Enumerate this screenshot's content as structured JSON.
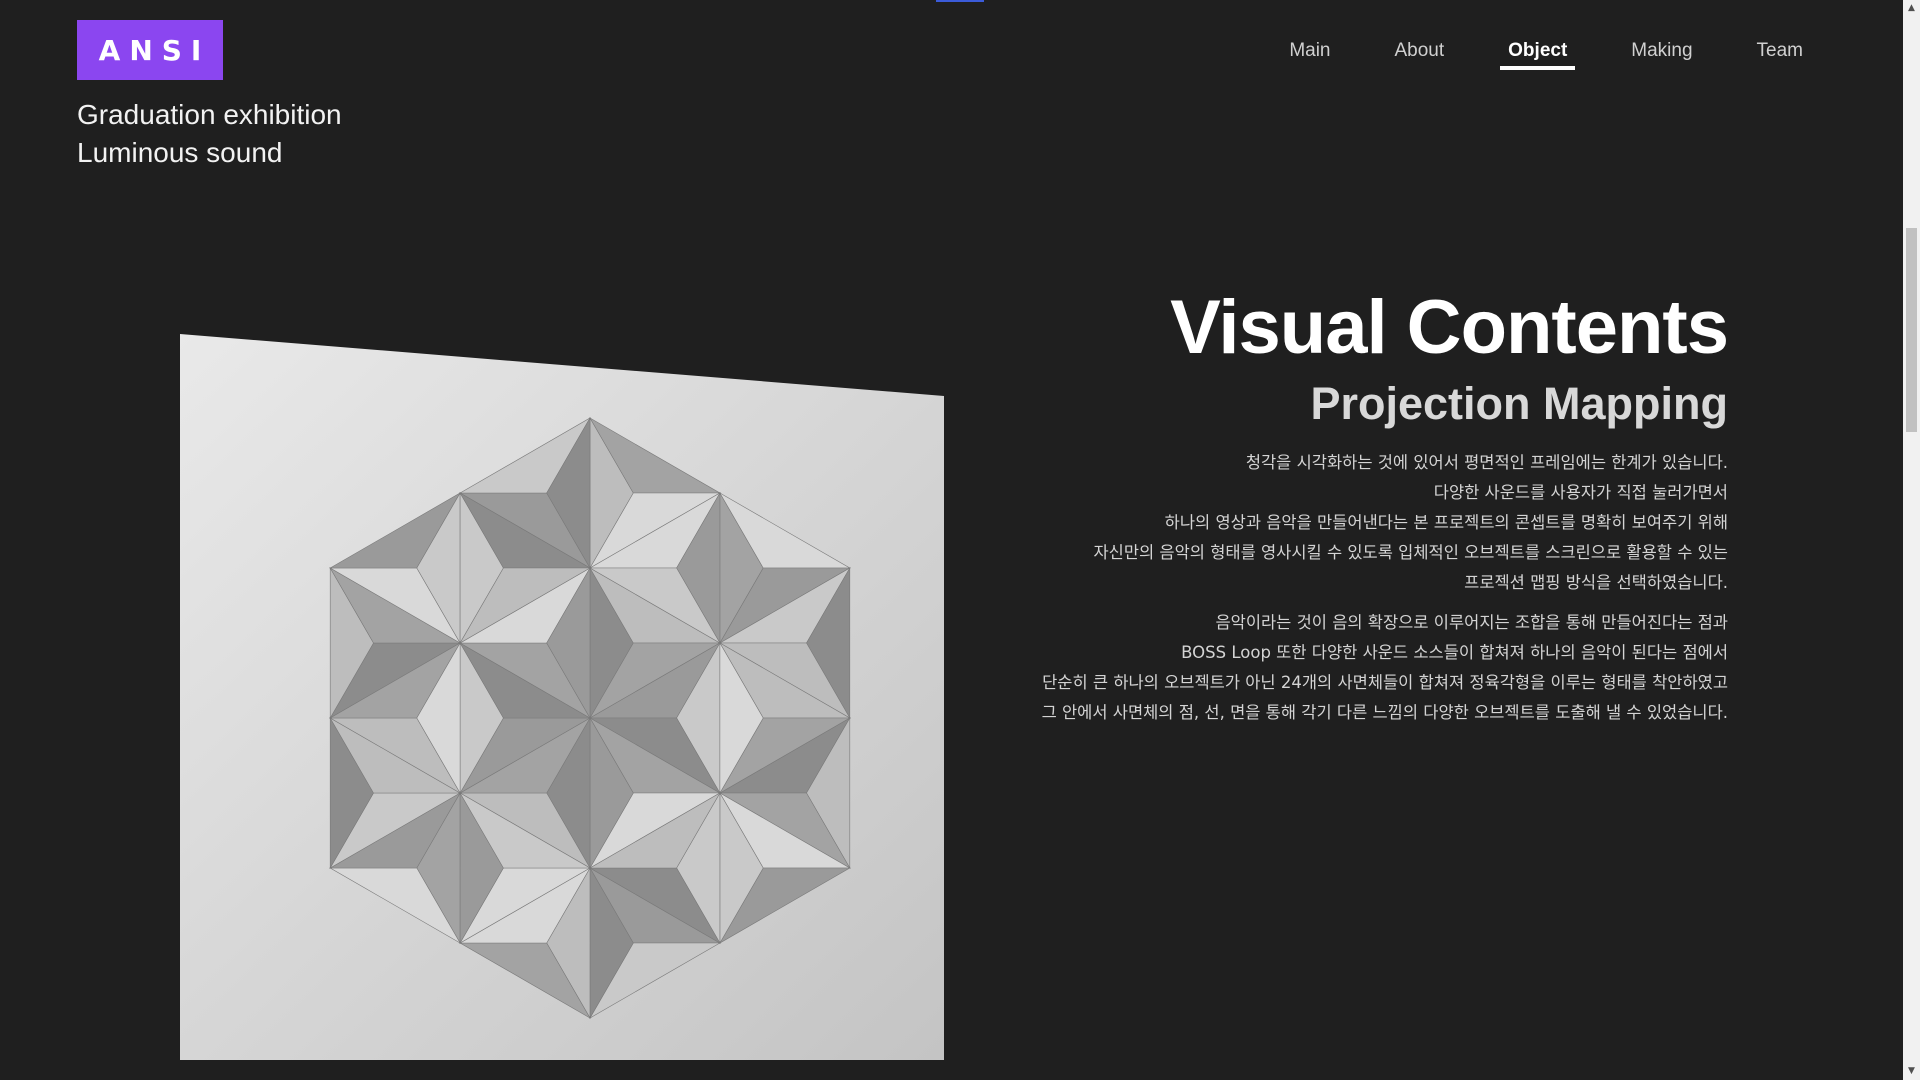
{
  "header": {
    "logo_text": "ANSI",
    "subtitle_lines": [
      "Graduation exhibition",
      "Luminous sound"
    ]
  },
  "nav": {
    "items": [
      {
        "label": "Main"
      },
      {
        "label": "About"
      },
      {
        "label": "Object"
      },
      {
        "label": "Making"
      },
      {
        "label": "Team"
      }
    ],
    "active": "Object"
  },
  "main": {
    "title": "Visual Contents",
    "subtitle": "Projection Mapping",
    "paragraph1": [
      "청각을 시각화하는 것에 있어서 평면적인 프레임에는 한계가 있습니다.",
      "다양한 사운드를 사용자가 직접 눌러가면서",
      "하나의 영상과 음악을 만들어낸다는 본 프로젝트의 콘셉트를 명확히 보여주기 위해",
      "자신만의 음악의 형태를 영사시킬 수 있도록 입체적인 오브젝트를 스크린으로 활용할 수 있는",
      "프로젝션 맵핑 방식을 선택하였습니다."
    ],
    "paragraph2": [
      "음악이라는 것이 음의 확장으로 이루어지는 조합을 통해 만들어진다는 점과",
      "BOSS Loop 또한 다양한 사운드 소스들이 합쳐져 하나의 음악이 된다는 점에서",
      "단순히 큰 하나의 오브젝트가 아닌 24개의 사면체들이 합쳐져 정육각형을 이루는 형태를 착안하였고",
      "그 안에서 사면체의 점, 선, 면을 통해 각기 다른 느낌의 다양한 오브젝트를 도출해 낼 수 있었습니다."
    ]
  },
  "colors": {
    "background": "#1f1f1f",
    "logo_bg": "#8b46f0",
    "text_primary": "#ffffff",
    "text_secondary": "#d4d4d4",
    "top_indicator": "#3b5bd9"
  },
  "icons": {
    "scroll_up": "scroll-up-arrow-icon",
    "scroll_down": "scroll-down-arrow-icon"
  }
}
